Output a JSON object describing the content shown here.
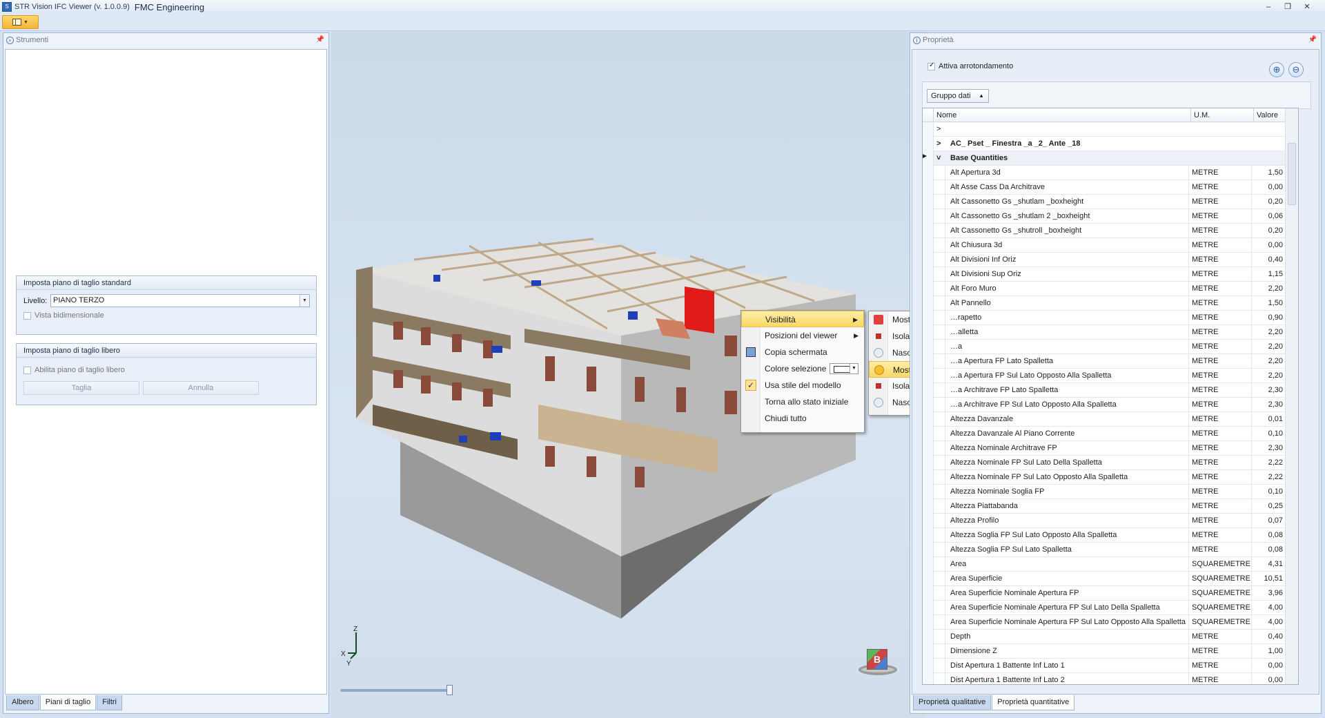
{
  "window": {
    "app_title": "STR Vision IFC Viewer (v. 1.0.0.9)",
    "company": "FMC Engineering",
    "controls": [
      "–",
      "❐",
      "✕"
    ]
  },
  "left_panel": {
    "title": "Strumenti",
    "group_standard": {
      "title": "Imposta piano di taglio standard",
      "level_label": "Livello:",
      "level_value": "PIANO TERZO",
      "twod_label": "Vista bidimensionale"
    },
    "group_free": {
      "title": "Imposta piano di taglio libero",
      "enable_label": "Abilita piano di taglio libero",
      "cut_button": "Taglia",
      "cancel_button": "Annulla"
    },
    "tabs": [
      "Albero",
      "Piani di taglio",
      "Filtri"
    ],
    "active_tab": "Piani di taglio"
  },
  "viewport": {
    "axes": {
      "z": "Z",
      "x": "X",
      "y": "Y"
    },
    "nav_cube_label": "B",
    "context_menu": {
      "items": [
        {
          "label": "Visibilità",
          "submenu": true,
          "highlighted": true
        },
        {
          "label": "Posizioni del viewer",
          "submenu": true
        },
        {
          "label": "Copia schermata",
          "icon": "screenshot-icon"
        },
        {
          "label": "Colore selezione",
          "color_picker": true
        },
        {
          "label": "Usa stile del modello",
          "checked": true
        },
        {
          "label": "Torna allo stato iniziale"
        },
        {
          "label": "Chiudi tutto"
        }
      ],
      "submenu": [
        {
          "label": "Mostra tutto",
          "icon": "show-all-icon"
        },
        {
          "label": "Isola",
          "icon": "isolate-icon"
        },
        {
          "label": "Nascondi",
          "icon": "hide-bulb-icon"
        },
        {
          "label": "Mostra simili",
          "icon": "bulb-on-icon",
          "highlighted": true
        },
        {
          "label": "Isola simili",
          "icon": "isolate-similar-icon"
        },
        {
          "label": "Nascondi simili",
          "icon": "hide-similar-icon"
        }
      ]
    }
  },
  "right_panel": {
    "title": "Proprietà",
    "rounding_label": "Attiva arrotondamento",
    "group_button": "Gruppo dati",
    "columns": [
      "Nome",
      "U.M.",
      "Valore"
    ],
    "groups": [
      "AC_ Pset _ Finestra _a _2_ Ante _18",
      "Base Quantities"
    ],
    "rows": [
      [
        "Alt Apertura 3d",
        "METRE",
        "1,50"
      ],
      [
        "Alt Asse Cass Da Architrave",
        "METRE",
        "0,00"
      ],
      [
        "Alt Cassonetto Gs _shutlam _boxheight",
        "METRE",
        "0,20"
      ],
      [
        "Alt Cassonetto Gs _shutlam 2 _boxheight",
        "METRE",
        "0,06"
      ],
      [
        "Alt Cassonetto Gs _shutroll _boxheight",
        "METRE",
        "0,20"
      ],
      [
        "Alt Chiusura 3d",
        "METRE",
        "0,00"
      ],
      [
        "Alt Divisioni Inf Oriz",
        "METRE",
        "0,40"
      ],
      [
        "Alt Divisioni Sup Oriz",
        "METRE",
        "1,15"
      ],
      [
        "Alt Foro Muro",
        "METRE",
        "2,20"
      ],
      [
        "Alt Pannello",
        "METRE",
        "1,50"
      ],
      [
        "…rapetto",
        "METRE",
        "0,90"
      ],
      [
        "…alletta",
        "METRE",
        "2,20"
      ],
      [
        "…a",
        "METRE",
        "2,20"
      ],
      [
        "…a Apertura FP Lato Spalletta",
        "METRE",
        "2,20"
      ],
      [
        "…a Apertura FP Sul Lato Opposto Alla Spalletta",
        "METRE",
        "2,20"
      ],
      [
        "…a Architrave FP Lato Spalletta",
        "METRE",
        "2,30"
      ],
      [
        "…a Architrave FP Sul Lato Opposto Alla Spalletta",
        "METRE",
        "2,30"
      ],
      [
        "Altezza Davanzale",
        "METRE",
        "0,01"
      ],
      [
        "Altezza Davanzale Al Piano Corrente",
        "METRE",
        "0,10"
      ],
      [
        "Altezza Nominale Architrave FP",
        "METRE",
        "2,30"
      ],
      [
        "Altezza Nominale FP Sul Lato Della Spalletta",
        "METRE",
        "2,22"
      ],
      [
        "Altezza Nominale FP Sul Lato Opposto Alla Spalletta",
        "METRE",
        "2,22"
      ],
      [
        "Altezza Nominale Soglia FP",
        "METRE",
        "0,10"
      ],
      [
        "Altezza Piattabanda",
        "METRE",
        "0,25"
      ],
      [
        "Altezza Profilo",
        "METRE",
        "0,07"
      ],
      [
        "Altezza Soglia FP Sul Lato Opposto Alla Spalletta",
        "METRE",
        "0,08"
      ],
      [
        "Altezza Soglia FP Sul Lato Spalletta",
        "METRE",
        "0,08"
      ],
      [
        "Area",
        "SQUAREMETRE",
        "4,31"
      ],
      [
        "Area Superficie",
        "SQUAREMETRE",
        "10,51"
      ],
      [
        "Area Superficie Nominale Apertura FP",
        "SQUAREMETRE",
        "3,96"
      ],
      [
        "Area Superficie Nominale Apertura FP Sul Lato Della Spalletta",
        "SQUAREMETRE",
        "4,00"
      ],
      [
        "Area Superficie Nominale Apertura FP Sul Lato Opposto Alla Spalletta",
        "SQUAREMETRE",
        "4,00"
      ],
      [
        "Depth",
        "METRE",
        "0,40"
      ],
      [
        "Dimensione Z",
        "METRE",
        "1,00"
      ],
      [
        "Dist Apertura 1 Battente Inf Lato 1",
        "METRE",
        "0,00"
      ],
      [
        "Dist Apertura 1 Battente Inf Lato 2",
        "METRE",
        "0,00"
      ]
    ],
    "tabs": [
      "Proprietà qualitative",
      "Proprietà quantitative"
    ],
    "active_tab": "Proprietà quantitative"
  }
}
